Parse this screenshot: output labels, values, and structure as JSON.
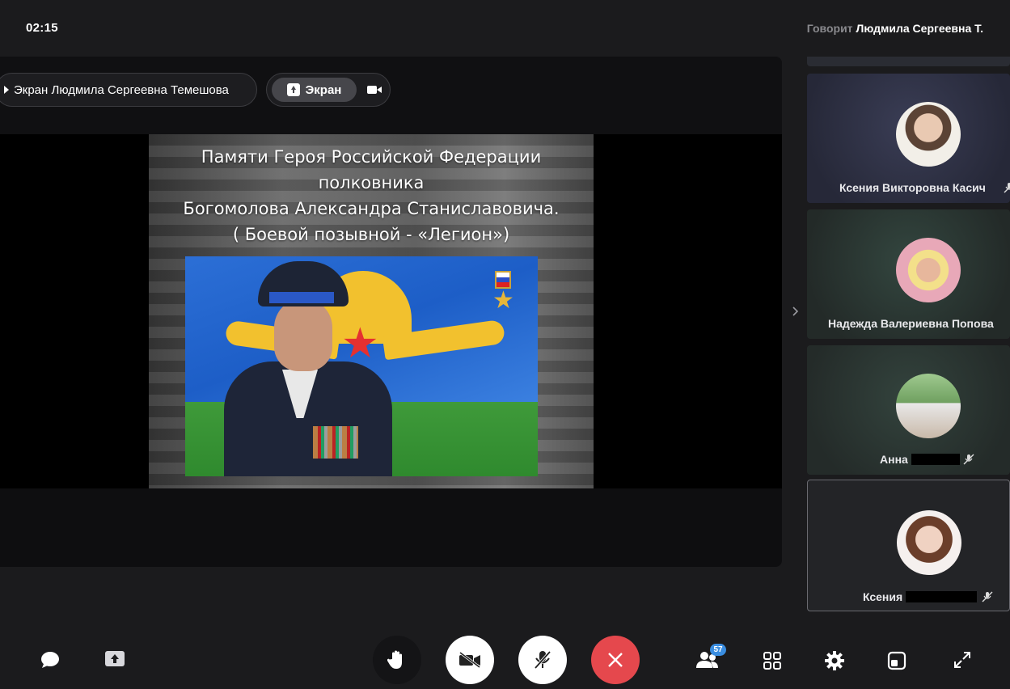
{
  "header": {
    "timer": "02:15",
    "speaker_prefix": "Говорит",
    "speaker_name": "Людмила Сергеевна Т."
  },
  "stage": {
    "presenter_label": "Экран Людмила Сергеевна Темешова",
    "screen_button_label": "Экран"
  },
  "slide": {
    "line1": "Памяти Героя Российской Федерации",
    "line2": "полковника",
    "line3": "Богомолова Александра Станиславовича.",
    "line4": "( Боевой позывной - «Легион»)"
  },
  "participants": [
    {
      "name": "Ксения Викторовна Касич"
    },
    {
      "name": "Надежда Валериевна Попова"
    },
    {
      "name": "Анна"
    },
    {
      "name": "Ксения"
    }
  ],
  "toolbar": {
    "participants_count": "57"
  },
  "colors": {
    "background": "#1b1b1d",
    "end_call": "#e5484d",
    "badge": "#3a8de0"
  }
}
